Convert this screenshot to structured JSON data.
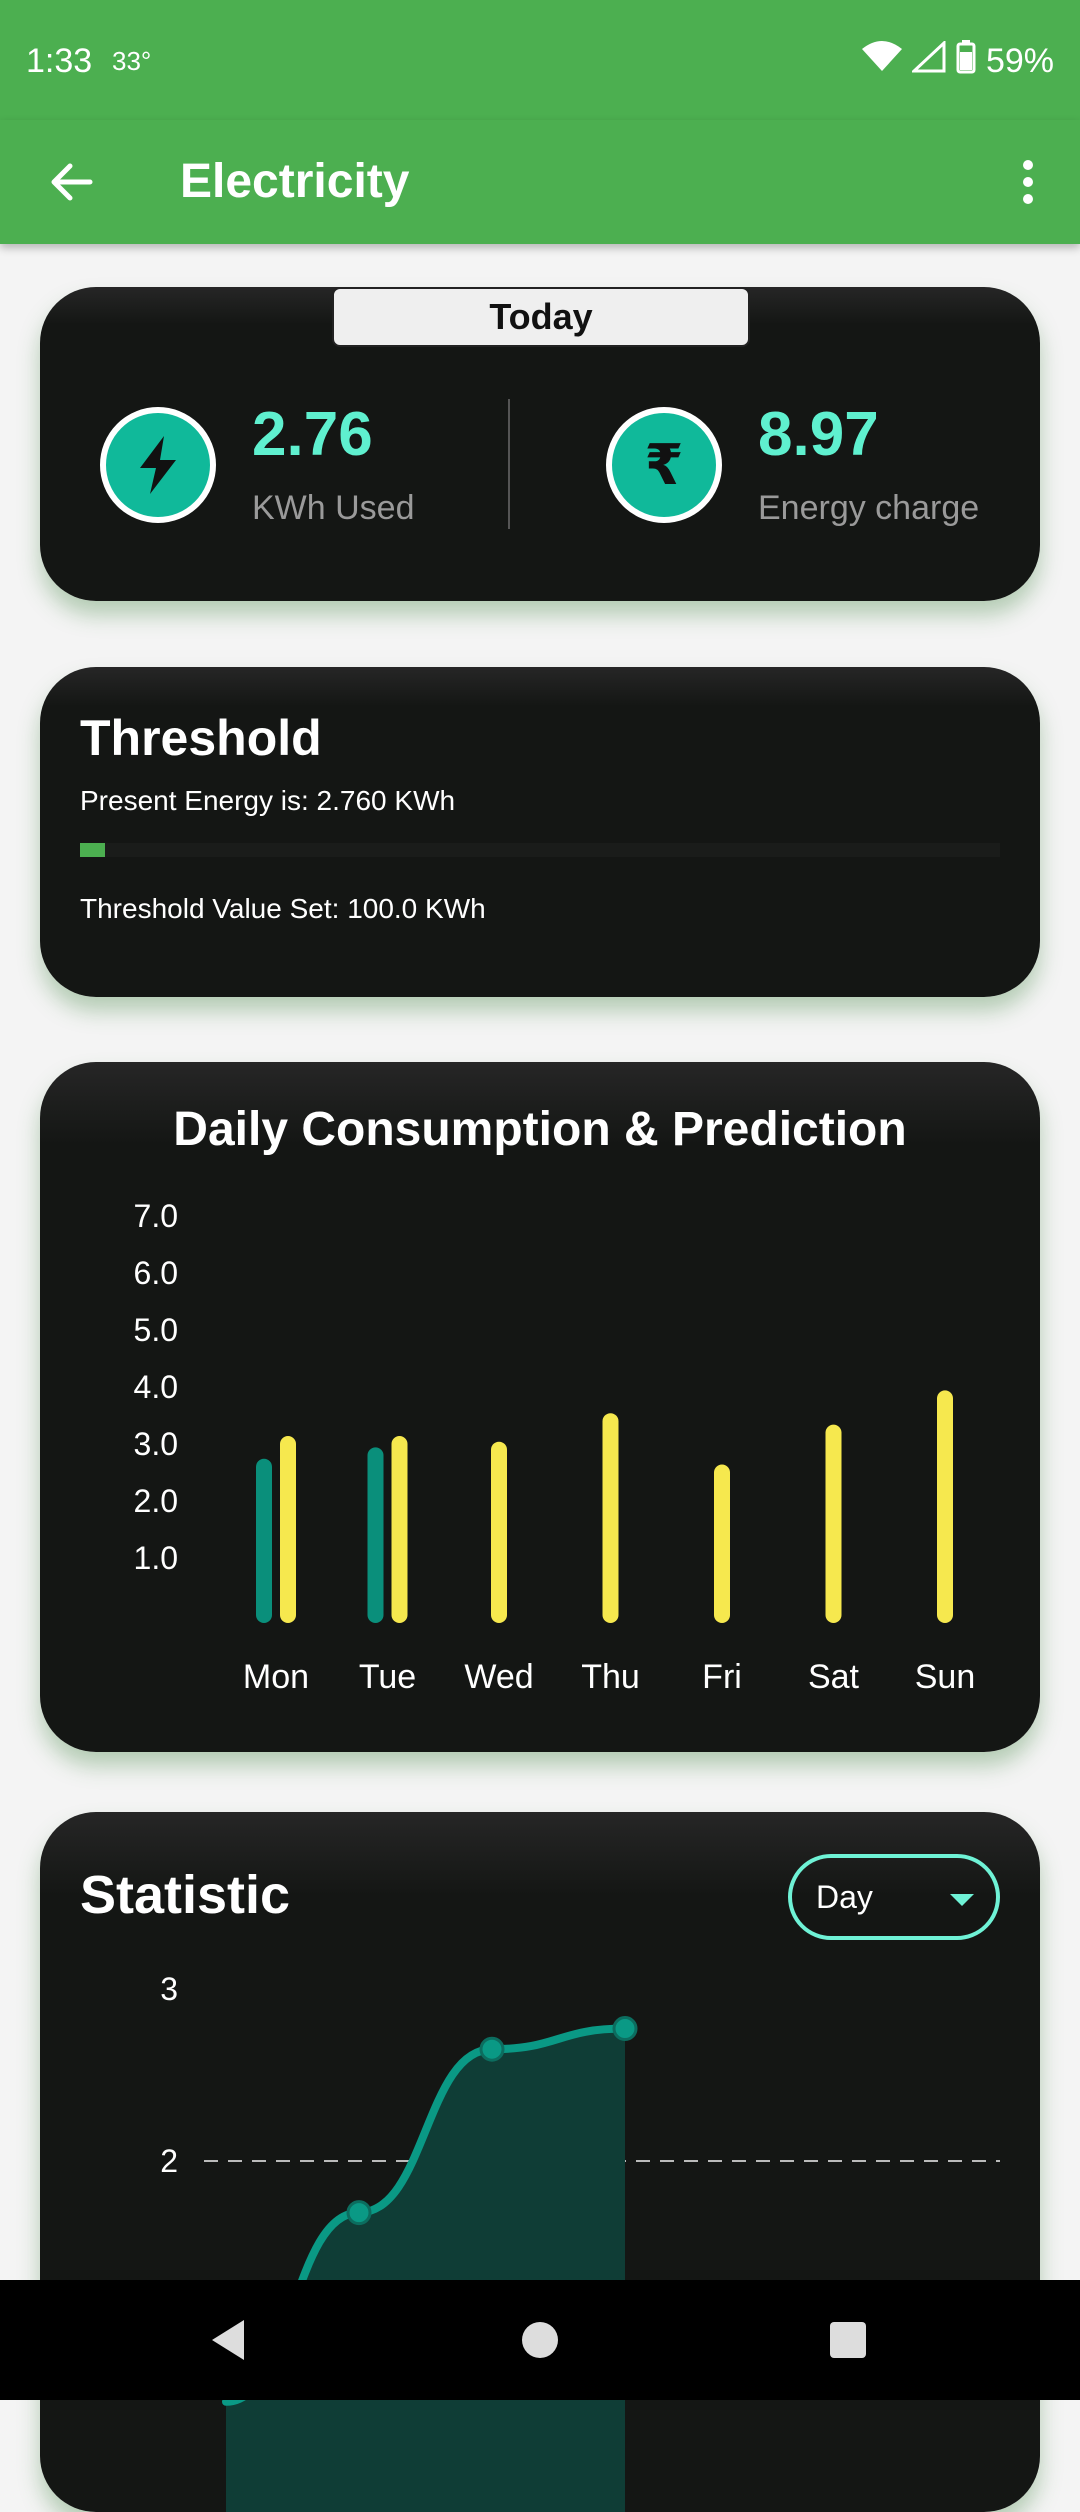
{
  "status_bar": {
    "time": "1:33",
    "temperature": "33°",
    "battery": "59%"
  },
  "app_bar": {
    "title": "Electricity"
  },
  "today": {
    "tab_label": "Today",
    "energy": {
      "value": "2.76",
      "label": "KWh Used",
      "icon": "bolt-icon"
    },
    "charge": {
      "value": "8.97",
      "label": "Energy charge",
      "icon": "rupee-icon"
    }
  },
  "threshold": {
    "title": "Threshold",
    "present_text": "Present Energy is: 2.760 KWh",
    "set_text": "Threshold Value Set: 100.0 KWh",
    "progress_fraction": 0.0276,
    "progress_color": "#4caf50"
  },
  "daily": {
    "title": "Daily Consumption & Prediction"
  },
  "statistic": {
    "title": "Statistic",
    "dropdown_value": "Day"
  },
  "chart_data": [
    {
      "type": "bar",
      "title": "Daily Consumption & Prediction",
      "categories": [
        "Mon",
        "Tue",
        "Wed",
        "Thu",
        "Fri",
        "Sat",
        "Sun"
      ],
      "y_ticks": [
        "1.0",
        "2.0",
        "3.0",
        "4.0",
        "5.0",
        "6.0",
        "7.0"
      ],
      "ylim": [
        0,
        7
      ],
      "series": [
        {
          "color": "#0a8f7b",
          "values": [
            2.6,
            2.8,
            null,
            null,
            null,
            null,
            null
          ]
        },
        {
          "color": "#f6e84e",
          "values": [
            3.0,
            3.0,
            2.9,
            3.4,
            2.5,
            3.2,
            3.8
          ]
        }
      ],
      "grid": false
    },
    {
      "type": "area",
      "title": "Statistic",
      "y_ticks": [
        "2",
        "3"
      ],
      "x": [
        0,
        1,
        2,
        3
      ],
      "values": [
        0.6,
        1.7,
        2.65,
        2.77
      ],
      "color": "#0a9985",
      "reference_line": 2,
      "grid": false
    }
  ]
}
